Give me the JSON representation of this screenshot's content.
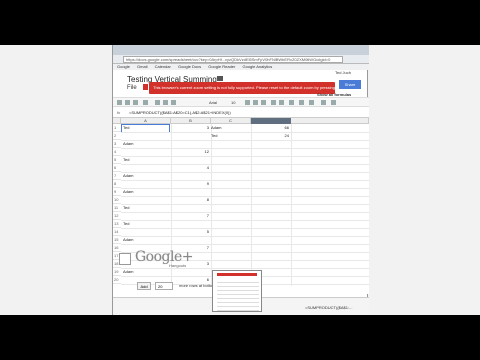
{
  "browser": {
    "url": "https://docs.google.com/spreadsheet/ccc?key=0ArpHf...xyzQDkVzdEl5SmFpV0hFNlBWbERvZ0ZXM0tlWGc#gid=0",
    "bookmarks": [
      "Google",
      "Gmail",
      "Calendar",
      "Google Docs",
      "Google Reader",
      "Google Analytics"
    ]
  },
  "doc": {
    "title": "Testing Vertical Summing",
    "menu": "File",
    "user": "Ted Juch",
    "share_label": "Share",
    "show_all_formulas": "Show all formulas",
    "banner": "This browser's current zoom setting is not fully supported. Please reset to the default zoom by pressing Ctrl+0."
  },
  "toolbar": {
    "font": "Arial",
    "size": "10"
  },
  "formula_bar": {
    "fx": "fx",
    "formula": "=SUMPRODUCT(($A$1:A$20=C1),A$2:A$21+INDEX(0))"
  },
  "grid": {
    "columns": [
      "A",
      "B",
      "C",
      "D"
    ],
    "rows": [
      {
        "num": "1",
        "a": "Ted",
        "b": "3",
        "d": "Adam",
        "e": "66"
      },
      {
        "num": "2",
        "a": "",
        "b": "",
        "d": "Ted",
        "e": "24"
      },
      {
        "num": "3",
        "a": "Adam",
        "b": "",
        "d": "",
        "e": ""
      },
      {
        "num": "4",
        "a": "",
        "b": "12",
        "d": "",
        "e": ""
      },
      {
        "num": "5",
        "a": "Ted",
        "b": "",
        "d": "",
        "e": ""
      },
      {
        "num": "6",
        "a": "",
        "b": "4",
        "d": "",
        "e": ""
      },
      {
        "num": "7",
        "a": "Adam",
        "b": "",
        "d": "",
        "e": ""
      },
      {
        "num": "8",
        "a": "",
        "b": "9",
        "d": "",
        "e": ""
      },
      {
        "num": "9",
        "a": "Adam",
        "b": "",
        "d": "",
        "e": ""
      },
      {
        "num": "10",
        "a": "",
        "b": "8",
        "d": "",
        "e": ""
      },
      {
        "num": "11",
        "a": "Ted",
        "b": "",
        "d": "",
        "e": ""
      },
      {
        "num": "12",
        "a": "",
        "b": "7",
        "d": "",
        "e": ""
      },
      {
        "num": "13",
        "a": "Ted",
        "b": "",
        "d": "",
        "e": ""
      },
      {
        "num": "14",
        "a": "",
        "b": "5",
        "d": "",
        "e": ""
      },
      {
        "num": "15",
        "a": "Adam",
        "b": "",
        "d": "",
        "e": ""
      },
      {
        "num": "16",
        "a": "",
        "b": "7",
        "d": "",
        "e": ""
      },
      {
        "num": "17",
        "a": "Ted",
        "b": "",
        "d": "",
        "e": ""
      },
      {
        "num": "18",
        "a": "",
        "b": "3",
        "d": "",
        "e": ""
      },
      {
        "num": "19",
        "a": "Adam",
        "b": "",
        "d": "",
        "e": ""
      },
      {
        "num": "20",
        "a": "",
        "b": "6",
        "d": "",
        "e": ""
      }
    ]
  },
  "add_rows": {
    "button": "Add",
    "count": "20",
    "text": "more rows at bottom."
  },
  "bottom": {
    "sheet_formula": "=SUMPRODUCT(($A$1:..."
  },
  "overlay": {
    "logo": "Google+",
    "sub": "Hangouts"
  }
}
